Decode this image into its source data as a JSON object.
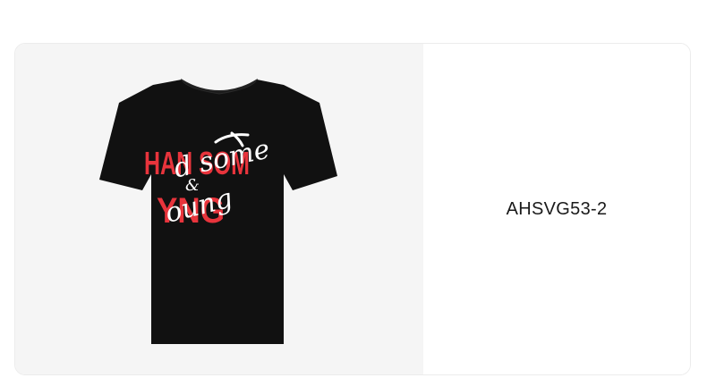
{
  "product": {
    "sku": "AHSVG53-2",
    "image": {
      "subject": "t-shirt-icon",
      "shirt_color": "#111111",
      "print_red": "#e8343c",
      "print_white": "#ffffff",
      "print_line1_block": "HAN SOM",
      "print_line1_script": "d some",
      "print_amp": "&",
      "print_line2_block": "YNG",
      "print_line2_script": "oung"
    }
  }
}
